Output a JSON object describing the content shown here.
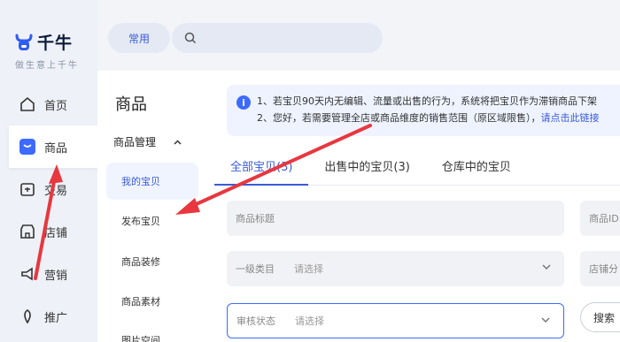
{
  "brand": {
    "name": "千牛",
    "tagline": "做生意上千牛"
  },
  "nav": [
    {
      "label": "首页",
      "icon": "home-icon"
    },
    {
      "label": "商品",
      "icon": "goods-icon"
    },
    {
      "label": "交易",
      "icon": "trade-icon"
    },
    {
      "label": "店铺",
      "icon": "shop-icon"
    },
    {
      "label": "营销",
      "icon": "marketing-icon"
    },
    {
      "label": "推广",
      "icon": "promotion-icon"
    }
  ],
  "topbar": {
    "pill_label": "常用",
    "search_placeholder": ""
  },
  "submenu": {
    "title": "商品",
    "group": "商品管理",
    "items": [
      {
        "label": "我的宝贝"
      },
      {
        "label": "发布宝贝"
      },
      {
        "label": "商品装修"
      },
      {
        "label": "商品素材"
      },
      {
        "label": "图片空间"
      }
    ]
  },
  "notice": {
    "line1": "1、若宝贝90天内无编辑、流量或出售的行为，系统将把宝贝作为滞销商品下架",
    "line2": "2、您好，若需要管理全店或商品维度的销售范围（原区域限售），",
    "link": "请点击此链接"
  },
  "tabs": [
    {
      "label": "全部宝贝(3)"
    },
    {
      "label": "出售中的宝贝(3)"
    },
    {
      "label": "仓库中的宝贝"
    }
  ],
  "filters": {
    "title_placeholder": "商品标题",
    "id_placeholder": "商品ID",
    "category_label": "一级类目",
    "category_value": "请选择",
    "shop_category_label": "店铺分",
    "audit_label": "审核状态",
    "audit_value": "请选择",
    "search_label": "搜索"
  },
  "colors": {
    "accent": "#3d6bff",
    "annotation": "#e8373f"
  }
}
